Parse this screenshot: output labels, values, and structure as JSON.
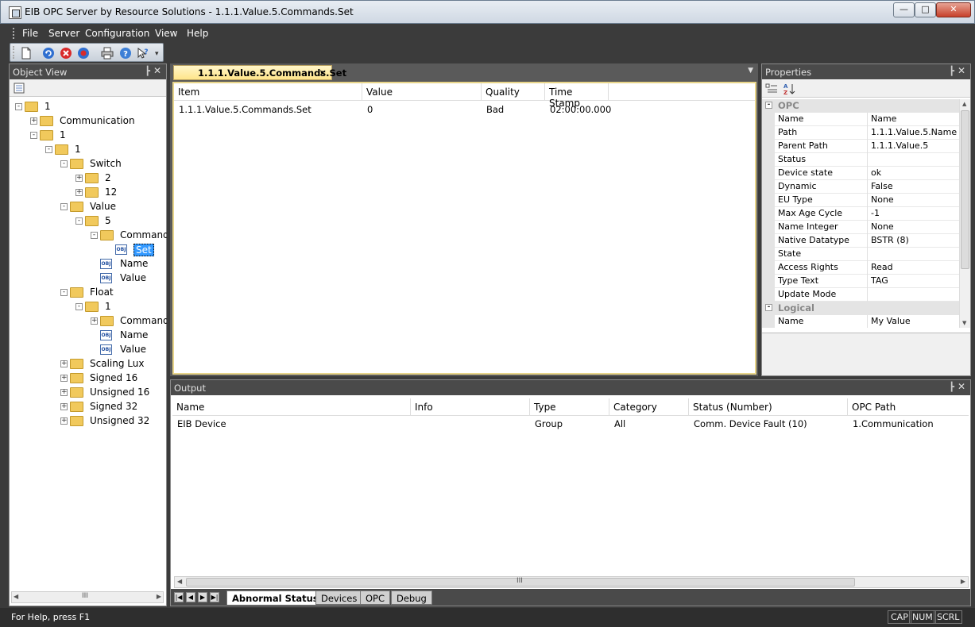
{
  "window": {
    "title": "EIB OPC Server by Resource Solutions - 1.1.1.Value.5.Commands.Set"
  },
  "menu": [
    "File",
    "Server",
    "Configuration",
    "View",
    "Help"
  ],
  "toolbar": {
    "icons": [
      "new-document-icon",
      "refresh-icon",
      "stop-icon",
      "disconnect-icon",
      "print-icon",
      "help-icon",
      "whats-this-icon"
    ]
  },
  "object_view": {
    "title": "Object View",
    "tree": [
      {
        "label": "1",
        "icon": "folder-open"
      },
      {
        "label": "Communication",
        "icon": "folder"
      },
      {
        "label": "1",
        "icon": "folder-open"
      },
      {
        "label": "1",
        "icon": "folder-open"
      },
      {
        "label": "Switch",
        "icon": "folder-open"
      },
      {
        "label": "2",
        "icon": "folder"
      },
      {
        "label": "12",
        "icon": "folder"
      },
      {
        "label": "Value",
        "icon": "folder-open"
      },
      {
        "label": "5",
        "icon": "folder-open"
      },
      {
        "label": "Commands",
        "icon": "folder-open"
      },
      {
        "label": "Set",
        "icon": "object",
        "selected": true
      },
      {
        "label": "Name",
        "icon": "object"
      },
      {
        "label": "Value",
        "icon": "object"
      },
      {
        "label": "Float",
        "icon": "folder-open"
      },
      {
        "label": "1",
        "icon": "folder-open"
      },
      {
        "label": "Commands",
        "icon": "folder"
      },
      {
        "label": "Name",
        "icon": "object"
      },
      {
        "label": "Value",
        "icon": "object"
      },
      {
        "label": "Scaling Lux",
        "icon": "folder"
      },
      {
        "label": "Signed 16",
        "icon": "folder"
      },
      {
        "label": "Unsigned 16",
        "icon": "folder"
      },
      {
        "label": "Signed 32",
        "icon": "folder"
      },
      {
        "label": "Unsigned 32",
        "icon": "folder"
      }
    ]
  },
  "document": {
    "tab_label": "1.1.1.Value.5.Commands.Set",
    "columns": [
      "Item",
      "Value",
      "Quality",
      "Time Stamp"
    ],
    "rows": [
      [
        "1.1.1.Value.5.Commands.Set",
        "0",
        "Bad",
        "02:00:00.000"
      ]
    ]
  },
  "properties": {
    "title": "Properties",
    "categories": [
      {
        "name": "OPC",
        "rows": [
          [
            "Name",
            "Name"
          ],
          [
            "Path",
            "1.1.1.Value.5.Name"
          ],
          [
            "Parent Path",
            "1.1.1.Value.5"
          ],
          [
            "Status",
            ""
          ],
          [
            "Device state",
            "ok"
          ],
          [
            "Dynamic",
            "False"
          ],
          [
            "EU Type",
            "None"
          ],
          [
            "Max Age Cycle",
            "-1"
          ],
          [
            "Name Integer",
            "None"
          ],
          [
            "Native Datatype",
            "BSTR (8)"
          ],
          [
            "State",
            ""
          ],
          [
            "Access Rights",
            "Read"
          ],
          [
            "Type Text",
            "TAG"
          ],
          [
            "Update Mode",
            ""
          ]
        ]
      },
      {
        "name": "Logical",
        "rows": [
          [
            "Name",
            "My Value"
          ]
        ]
      }
    ]
  },
  "output": {
    "title": "Output",
    "columns": [
      "Name",
      "Info",
      "Type",
      "Category",
      "Status (Number)",
      "OPC Path"
    ],
    "rows": [
      [
        "EIB Device",
        "",
        "Group",
        "All",
        "Comm. Device Fault (10)",
        "1.Communication"
      ]
    ],
    "tabs": [
      "Abnormal Statuses",
      "Devices",
      "OPC",
      "Debug"
    ],
    "active_tab": "Abnormal Statuses"
  },
  "statusbar": {
    "text": "For Help, press F1",
    "indicators": [
      "CAP",
      "NUM",
      "SCRL"
    ]
  }
}
